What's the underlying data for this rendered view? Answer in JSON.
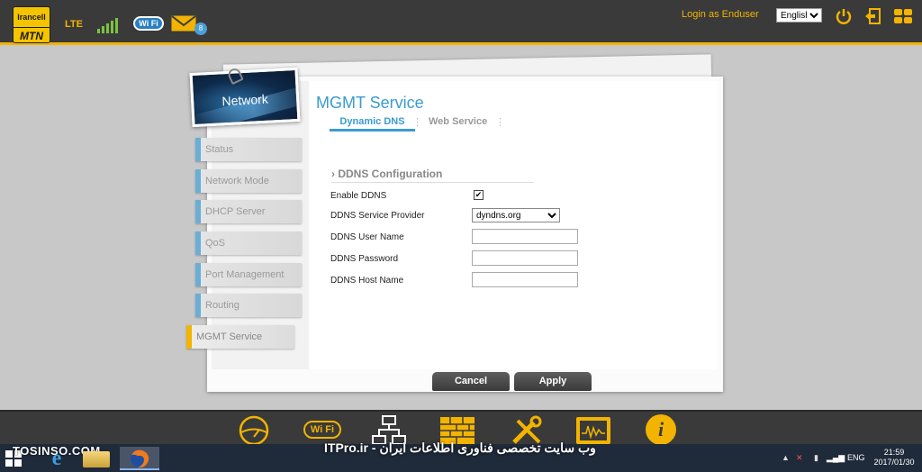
{
  "header": {
    "logo_top": "Irancell",
    "logo_bottom": "MTN",
    "network_type": "LTE",
    "wifi_badge": "Wi Fi",
    "mail_count": "8",
    "login_link": "Login as Enduser",
    "language": "English",
    "language_options": [
      "English"
    ],
    "accent_color": "#f2b400"
  },
  "sidebar": {
    "card_title": "Network",
    "items": [
      {
        "label": "Status"
      },
      {
        "label": "Network Mode"
      },
      {
        "label": "DHCP Server"
      },
      {
        "label": "QoS"
      },
      {
        "label": "Port Management"
      },
      {
        "label": "Routing"
      },
      {
        "label": "MGMT Service",
        "active": true
      }
    ]
  },
  "main": {
    "title": "MGMT Service",
    "tabs": [
      {
        "label": "Dynamic DNS",
        "active": true
      },
      {
        "label": "Web Service",
        "active": false
      }
    ],
    "section_title": "DDNS Configuration",
    "fields": {
      "enable_label": "Enable DDNS",
      "enable_checked": true,
      "provider_label": "DDNS Service Provider",
      "provider_value": "dyndns.org",
      "provider_options": [
        "dyndns.org"
      ],
      "username_label": "DDNS User Name",
      "username_value": "",
      "password_label": "DDNS Password",
      "password_value": "",
      "hostname_label": "DDNS Host Name",
      "hostname_value": ""
    },
    "buttons": {
      "cancel": "Cancel",
      "apply": "Apply"
    }
  },
  "bottom_nav": {
    "icons": [
      "dashboard-icon",
      "wifi-icon",
      "network-icon",
      "firewall-icon",
      "tools-icon",
      "device-icon",
      "info-icon"
    ],
    "wifi_label": "Wi Fi",
    "info_label": "i"
  },
  "taskbar": {
    "watermark_left": "TOSINSO.COM",
    "watermark_center": "ITPro.ir - وب سایت تخصصی فناوری اطلاعات ایران",
    "language": "ENG",
    "time": "21:59",
    "date": "2017/01/30"
  }
}
